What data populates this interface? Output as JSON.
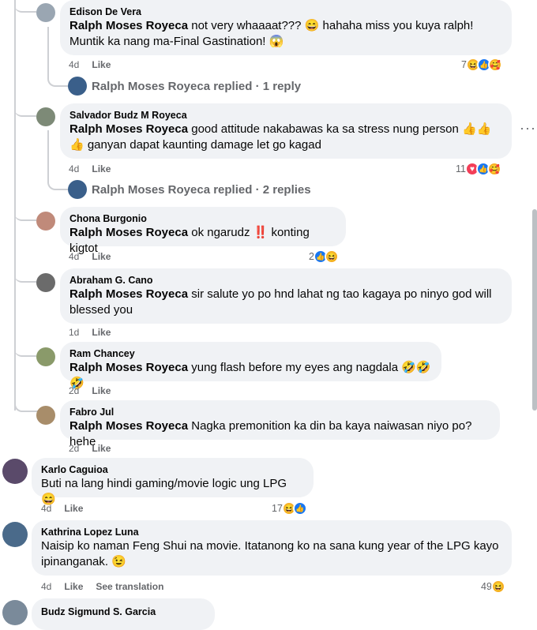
{
  "comments": [
    {
      "author": "Edison De Vera",
      "mention": "Ralph Moses Royeca",
      "text": " not very whaaaat??? 😄 hahaha miss you kuya ralph! Muntik ka nang ma-Final Gastination! 😱",
      "age": "4d",
      "like": "Like",
      "reaction_count": "7",
      "reply_summary": "Ralph Moses Royeca replied · 1 reply"
    },
    {
      "author": "Salvador Budz M Royeca",
      "mention": "Ralph Moses Royeca",
      "text": " good attitude nakabawas ka sa stress nung person 👍👍👍 ganyan dapat kaunting damage let go kagad",
      "age": "4d",
      "like": "Like",
      "reaction_count": "11",
      "reply_summary": "Ralph Moses Royeca replied · 2 replies"
    },
    {
      "author": "Chona Burgonio",
      "mention": "Ralph Moses Royeca",
      "text": " ok ngarudz ‼️ konting kigtot",
      "age": "4d",
      "like": "Like",
      "reaction_count": "2"
    },
    {
      "author": "Abraham G. Cano",
      "mention": "Ralph Moses Royeca",
      "text": " sir salute yo po hnd lahat ng tao kagaya po ninyo god will blessed you",
      "age": "1d",
      "like": "Like"
    },
    {
      "author": "Ram Chancey",
      "mention": "Ralph Moses Royeca",
      "text": " yung flash before my eyes ang nagdala 🤣🤣🤣",
      "age": "2d",
      "like": "Like"
    },
    {
      "author": "Fabro Jul",
      "mention": "Ralph Moses Royeca",
      "text": " Nagka premonition ka din ba kaya naiwasan niyo po? hehe",
      "age": "2d",
      "like": "Like"
    },
    {
      "author": "Karlo Caguioa",
      "text": "Buti na lang hindi gaming/movie logic ung LPG 😄",
      "age": "4d",
      "like": "Like",
      "reaction_count": "17"
    },
    {
      "author": "Kathrina Lopez Luna",
      "text": "Naisip ko naman Feng Shui na movie. Itatanong ko na sana kung year of the LPG kayo ipinanganak. 😉",
      "age": "4d",
      "like": "Like",
      "see_translation": "See translation",
      "reaction_count": "49"
    },
    {
      "author": "Budz Sigmund S. Garcia"
    }
  ],
  "more_options": "···",
  "colors": {
    "bubble": "#f0f2f5",
    "meta": "#65676b",
    "like_blue": "#1877f2",
    "love_red": "#f33e58",
    "haha_yellow": "#f7b125"
  }
}
